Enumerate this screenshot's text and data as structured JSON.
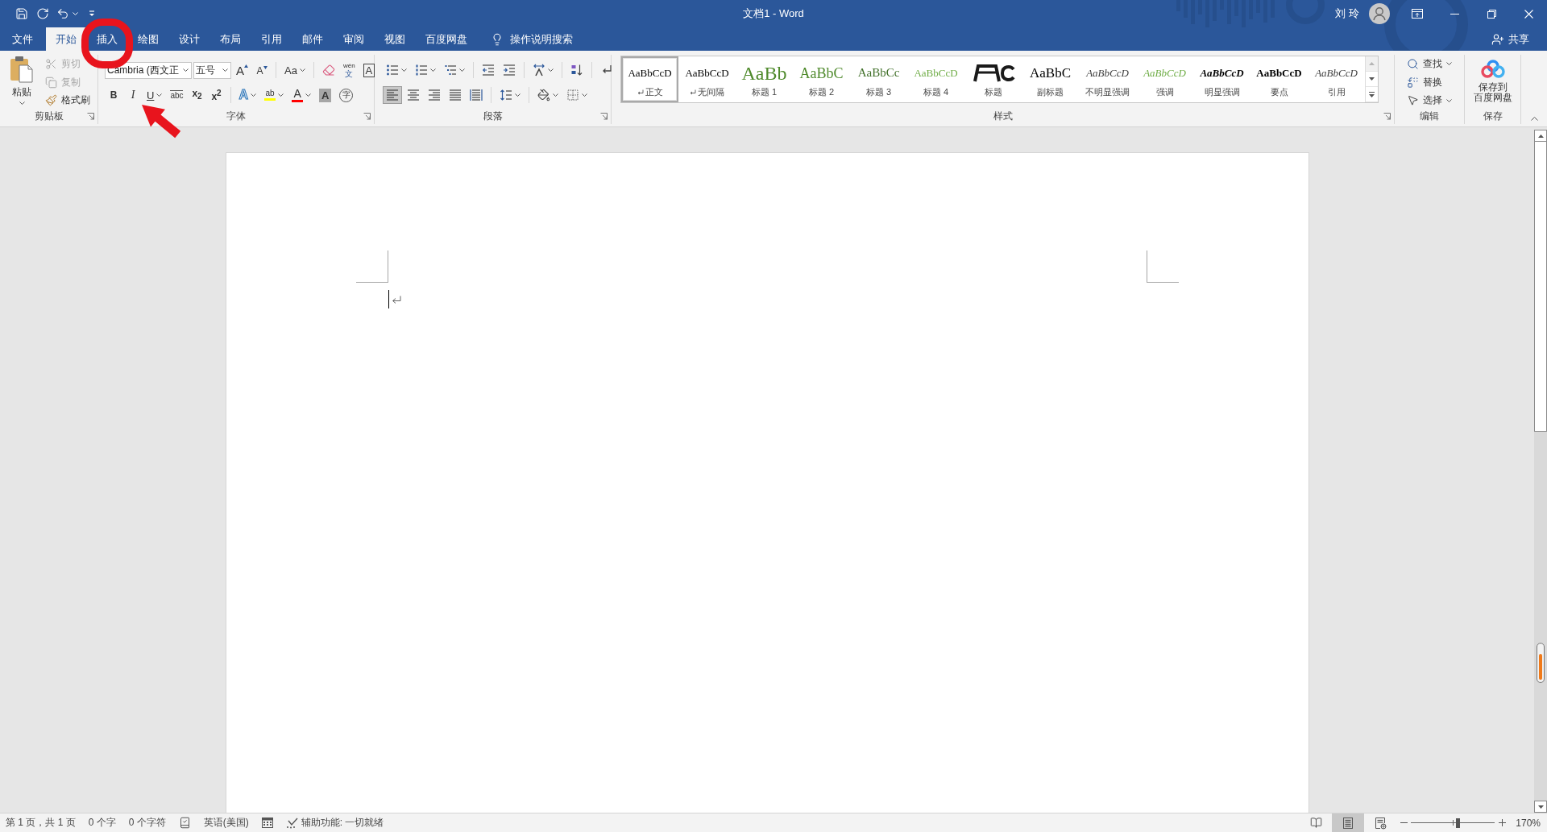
{
  "window": {
    "title": "文档1 - Word",
    "user_name": "刘 玲"
  },
  "quick_access": [
    {
      "kind": "save"
    },
    {
      "kind": "repeat"
    },
    {
      "kind": "undo"
    },
    {
      "kind": "customize"
    }
  ],
  "tabs": [
    {
      "label": "文件",
      "selected": false,
      "circled": false
    },
    {
      "label": "开始",
      "selected": true,
      "circled": false
    },
    {
      "label": "插入",
      "selected": false,
      "circled": true
    },
    {
      "label": "绘图",
      "selected": false,
      "circled": false
    },
    {
      "label": "设计",
      "selected": false,
      "circled": false
    },
    {
      "label": "布局",
      "selected": false,
      "circled": false
    },
    {
      "label": "引用",
      "selected": false,
      "circled": false
    },
    {
      "label": "邮件",
      "selected": false,
      "circled": false
    },
    {
      "label": "审阅",
      "selected": false,
      "circled": false
    },
    {
      "label": "视图",
      "selected": false,
      "circled": false
    },
    {
      "label": "百度网盘",
      "selected": false,
      "circled": false
    }
  ],
  "tell_me": {
    "label": "操作说明搜索"
  },
  "share": {
    "label": "共享"
  },
  "ribbon": {
    "clipboard": {
      "label": "剪贴板",
      "paste": {
        "label": "粘贴"
      },
      "commands": [
        {
          "kind": "cut",
          "label": "剪切",
          "disabled": true
        },
        {
          "kind": "copy",
          "label": "复制",
          "disabled": true
        },
        {
          "kind": "format-painter",
          "label": "格式刷",
          "disabled": false
        }
      ]
    },
    "font": {
      "label": "字体",
      "font_name": {
        "value": "Cambria (西文正"
      },
      "font_size": {
        "value": "五号"
      },
      "row_1": [
        {
          "kind": "grow-font",
          "label": "A"
        },
        {
          "kind": "shrink-font",
          "label": "A"
        },
        {
          "kind": "change-case",
          "label": "Aa"
        },
        {
          "kind": "clear-formatting"
        },
        {
          "kind": "phonetic-guide",
          "label": "wén",
          "sub_label": "文"
        },
        {
          "kind": "character-border",
          "label": "A"
        }
      ],
      "row_2": [
        {
          "kind": "bold",
          "label": "B"
        },
        {
          "kind": "italic",
          "label": "I"
        },
        {
          "kind": "underline",
          "label": "U"
        },
        {
          "kind": "strikethrough",
          "label": "abc"
        },
        {
          "kind": "subscript",
          "label": "x$_{2}$"
        },
        {
          "kind": "superscript",
          "label": "x$^{2}$"
        },
        {
          "kind": "text-effects",
          "label": "A"
        },
        {
          "kind": "highlight",
          "label": "ab",
          "color": "#ffff00"
        },
        {
          "kind": "font-color",
          "label": "A",
          "color": "#ff0000"
        },
        {
          "kind": "character-shading",
          "label": "A"
        },
        {
          "kind": "enclosed-character",
          "label": "字"
        }
      ]
    },
    "paragraph": {
      "label": "段落",
      "row_1": [
        {
          "kind": "bullets"
        },
        {
          "kind": "numbering"
        },
        {
          "kind": "multilevel-list"
        },
        {
          "kind": "decrease-indent"
        },
        {
          "kind": "increase-indent"
        },
        {
          "kind": "asian-layout"
        },
        {
          "kind": "sort"
        },
        {
          "kind": "show-marks"
        }
      ],
      "row_2": [
        {
          "kind": "align-left",
          "selected": true
        },
        {
          "kind": "align-center",
          "selected": false
        },
        {
          "kind": "align-right",
          "selected": false
        },
        {
          "kind": "justify",
          "selected": false
        },
        {
          "kind": "distribute",
          "selected": false
        },
        {
          "kind": "line-spacing",
          "selected": false
        },
        {
          "kind": "shading",
          "selected": false
        },
        {
          "kind": "borders",
          "selected": false
        }
      ]
    },
    "styles": {
      "label": "样式",
      "gallery": [
        {
          "name": "正文",
          "preview": "AaBbCcD",
          "kind": "normal",
          "paragraph_mark": true,
          "selected": true
        },
        {
          "name": "无间隔",
          "preview": "AaBbCcD",
          "kind": "no-spacing",
          "paragraph_mark": true,
          "selected": false
        },
        {
          "name": "标题 1",
          "preview": "AaBb",
          "kind": "heading-1",
          "paragraph_mark": false,
          "selected": false
        },
        {
          "name": "标题 2",
          "preview": "AaBbC",
          "kind": "heading-2",
          "paragraph_mark": false,
          "selected": false
        },
        {
          "name": "标题 3",
          "preview": "AaBbCc",
          "kind": "heading-3",
          "paragraph_mark": false,
          "selected": false
        },
        {
          "name": "标题 4",
          "preview": "AaBbCcD",
          "kind": "heading-4",
          "paragraph_mark": false,
          "selected": false
        },
        {
          "name": "标题",
          "kind": "title",
          "paragraph_mark": false,
          "selected": false
        },
        {
          "name": "副标题",
          "preview": "AaBbC",
          "kind": "subtitle",
          "paragraph_mark": false,
          "selected": false
        },
        {
          "name": "不明显强调",
          "preview": "AaBbCcD",
          "kind": "subtle-emphasis",
          "paragraph_mark": false,
          "selected": false
        },
        {
          "name": "强调",
          "preview": "AaBbCcD",
          "kind": "emphasis",
          "paragraph_mark": false,
          "selected": false
        },
        {
          "name": "明显强调",
          "preview": "AaBbCcD",
          "kind": "intense-emphasis",
          "paragraph_mark": false,
          "selected": false
        },
        {
          "name": "要点",
          "preview": "AaBbCcD",
          "kind": "strong",
          "paragraph_mark": false,
          "selected": false
        },
        {
          "name": "引用",
          "preview": "AaBbCcD",
          "kind": "quote",
          "paragraph_mark": false,
          "selected": false
        }
      ]
    },
    "editing": {
      "label": "编辑",
      "commands": [
        {
          "kind": "find",
          "label": "查找"
        },
        {
          "kind": "replace",
          "label": "替换"
        },
        {
          "kind": "select",
          "label": "选择"
        }
      ]
    },
    "save": {
      "label": "保存",
      "button": {
        "label_lines": [
          "保存到",
          "百度网盘"
        ]
      }
    }
  },
  "status_bar": {
    "items": [
      {
        "kind": "text",
        "label": "第 1 页，共 1 页"
      },
      {
        "kind": "text",
        "label": "0 个字"
      },
      {
        "kind": "text",
        "label": "0 个字符"
      },
      {
        "kind": "proofing"
      },
      {
        "kind": "text",
        "label": "英语(美国)"
      },
      {
        "kind": "macro"
      },
      {
        "kind": "accessibility",
        "label": "辅助功能: 一切就绪"
      }
    ],
    "views": [
      {
        "kind": "read",
        "selected": false
      },
      {
        "kind": "print",
        "selected": true
      },
      {
        "kind": "web",
        "selected": false
      }
    ],
    "zoom": {
      "level": 0.56,
      "reading": "170%"
    }
  },
  "pointer_arrow": true
}
